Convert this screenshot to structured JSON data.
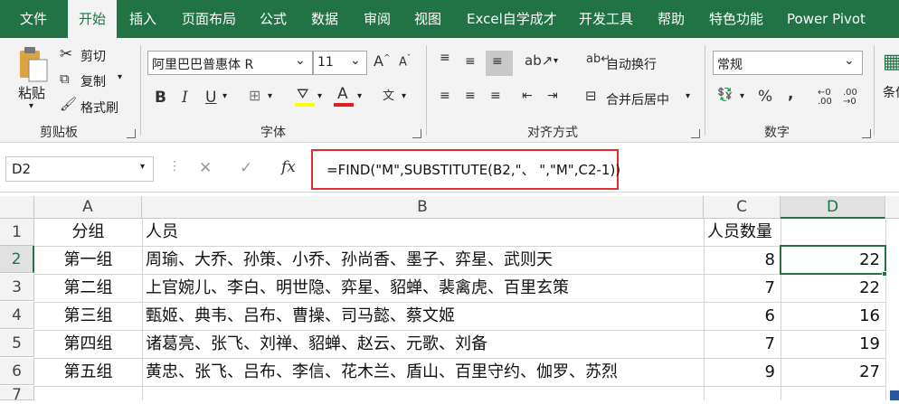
{
  "menu": {
    "tabs": [
      "文件",
      "开始",
      "插入",
      "页面布局",
      "公式",
      "数据",
      "审阅",
      "视图",
      "Excel自学成才",
      "开发工具",
      "帮助",
      "特色功能",
      "Power Pivot"
    ],
    "active_index": 1
  },
  "ribbon": {
    "clipboard": {
      "paste": "粘贴",
      "cut": "剪切",
      "copy": "复制",
      "format_painter": "格式刷",
      "label": "剪贴板"
    },
    "font": {
      "name": "阿里巴巴普惠体 R",
      "size": "11",
      "label": "字体"
    },
    "alignment": {
      "wrap_text": "自动换行",
      "merge_center": "合并后居中",
      "label": "对齐方式"
    },
    "number": {
      "format": "常规",
      "label": "数字"
    },
    "styles": {
      "partial": "条件"
    }
  },
  "formula_bar": {
    "name_box": "D2",
    "fx": "fx",
    "formula": "=FIND(\"M\",SUBSTITUTE(B2,\"、 \",\"M\",C2-1))"
  },
  "sheet": {
    "columns": [
      "A",
      "B",
      "C",
      "D"
    ],
    "rows": [
      "1",
      "2",
      "3",
      "4",
      "5",
      "6",
      "7"
    ],
    "selected_cell": "D2",
    "header_row": [
      "分组",
      "人员",
      "人员数量",
      ""
    ],
    "data": [
      [
        "第一组",
        "周瑜、大乔、孙策、小乔、孙尚香、墨子、弈星、武则天",
        "8",
        "22"
      ],
      [
        "第二组",
        "上官婉儿、李白、明世隐、弈星、貂蝉、裴禽虎、百里玄策",
        "7",
        "22"
      ],
      [
        "第三组",
        "甄姬、典韦、吕布、曹操、司马懿、蔡文姬",
        "6",
        "16"
      ],
      [
        "第四组",
        "诸葛亮、张飞、刘禅、貂蝉、赵云、元歌、刘备",
        "7",
        "19"
      ],
      [
        "第五组",
        "黄忠、张飞、吕布、李信、花木兰、盾山、百里守约、伽罗、苏烈",
        "9",
        "27"
      ]
    ]
  },
  "colors": {
    "accent": "#217346",
    "highlight_box": "#e03030"
  }
}
